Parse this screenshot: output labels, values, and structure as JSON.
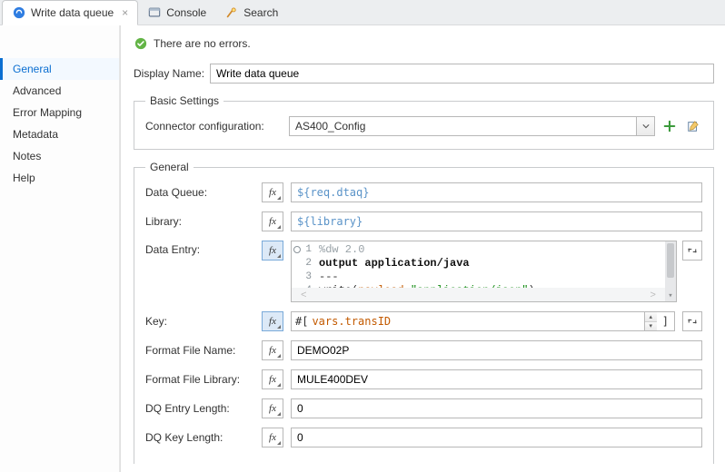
{
  "tabs": {
    "active": {
      "label": "Write data queue"
    },
    "console": {
      "label": "Console"
    },
    "search": {
      "label": "Search"
    }
  },
  "status": {
    "message": "There are no errors."
  },
  "sidebar": {
    "items": [
      {
        "label": "General"
      },
      {
        "label": "Advanced"
      },
      {
        "label": "Error Mapping"
      },
      {
        "label": "Metadata"
      },
      {
        "label": "Notes"
      },
      {
        "label": "Help"
      }
    ]
  },
  "displayName": {
    "label": "Display Name:",
    "value": "Write data queue"
  },
  "basicSettings": {
    "legend": "Basic Settings",
    "connectorConfigLabel": "Connector configuration:",
    "connectorConfigValue": "AS400_Config"
  },
  "general": {
    "legend": "General",
    "dataQueue": {
      "label": "Data Queue:",
      "value": "${req.dtaq}"
    },
    "library": {
      "label": "Library:",
      "value": "${library}"
    },
    "dataEntry": {
      "label": "Data Entry:",
      "code": {
        "l1": "%dw 2.0",
        "l2": "output application/java",
        "l3": "---",
        "l4_fn": "write",
        "l4_var": "payload",
        "l4_str": "\"application/json\""
      }
    },
    "key": {
      "label": "Key:",
      "prefix": "#[",
      "value": "vars.transID",
      "suffix": "]"
    },
    "formatFileName": {
      "label": "Format File Name:",
      "value": "DEMO02P"
    },
    "formatFileLibrary": {
      "label": "Format File Library:",
      "value": "MULE400DEV"
    },
    "dqEntryLength": {
      "label": "DQ Entry Length:",
      "value": "0"
    },
    "dqKeyLength": {
      "label": "DQ Key Length:",
      "value": "0"
    }
  }
}
